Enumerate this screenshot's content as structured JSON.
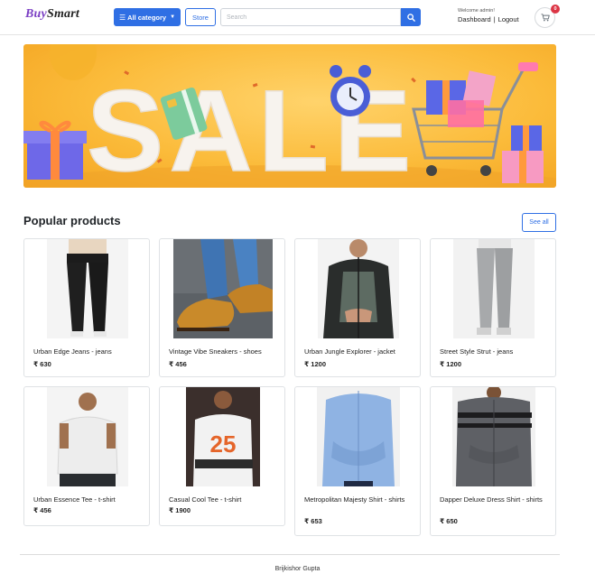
{
  "header": {
    "logo_part1": "Buy",
    "logo_part2": "Smart",
    "category_button": "All category",
    "store_button": "Store",
    "search_placeholder": "Search",
    "welcome_text": "Welcome admin!",
    "dashboard_link": "Dashboard",
    "separator": "|",
    "logout_link": "Logout",
    "cart_count": "0"
  },
  "banner": {
    "text": "SALE"
  },
  "section": {
    "title": "Popular products",
    "see_all": "See all"
  },
  "products": [
    {
      "name": "Urban Edge Jeans - jeans",
      "price": "₹ 630"
    },
    {
      "name": "Vintage Vibe Sneakers - shoes",
      "price": "₹ 456"
    },
    {
      "name": "Urban Jungle Explorer - jacket",
      "price": "₹ 1200"
    },
    {
      "name": "Street Style Strut - jeans",
      "price": "₹ 1200"
    },
    {
      "name": "Urban Essence Tee - t-shirt",
      "price": "₹ 456"
    },
    {
      "name": "Casual Cool Tee - t-shirt",
      "price": "₹ 1900"
    },
    {
      "name": "Metropolitan Majesty Shirt - shirts",
      "price": "₹ 653"
    },
    {
      "name": "Dapper Deluxe Dress Shirt - shirts",
      "price": "₹ 650"
    }
  ],
  "footer": {
    "text": "Brijkishor Gupta"
  },
  "colors": {
    "primary": "#2f6fe4",
    "badge": "#dc3545",
    "banner_bg": "#fbbb3a"
  }
}
